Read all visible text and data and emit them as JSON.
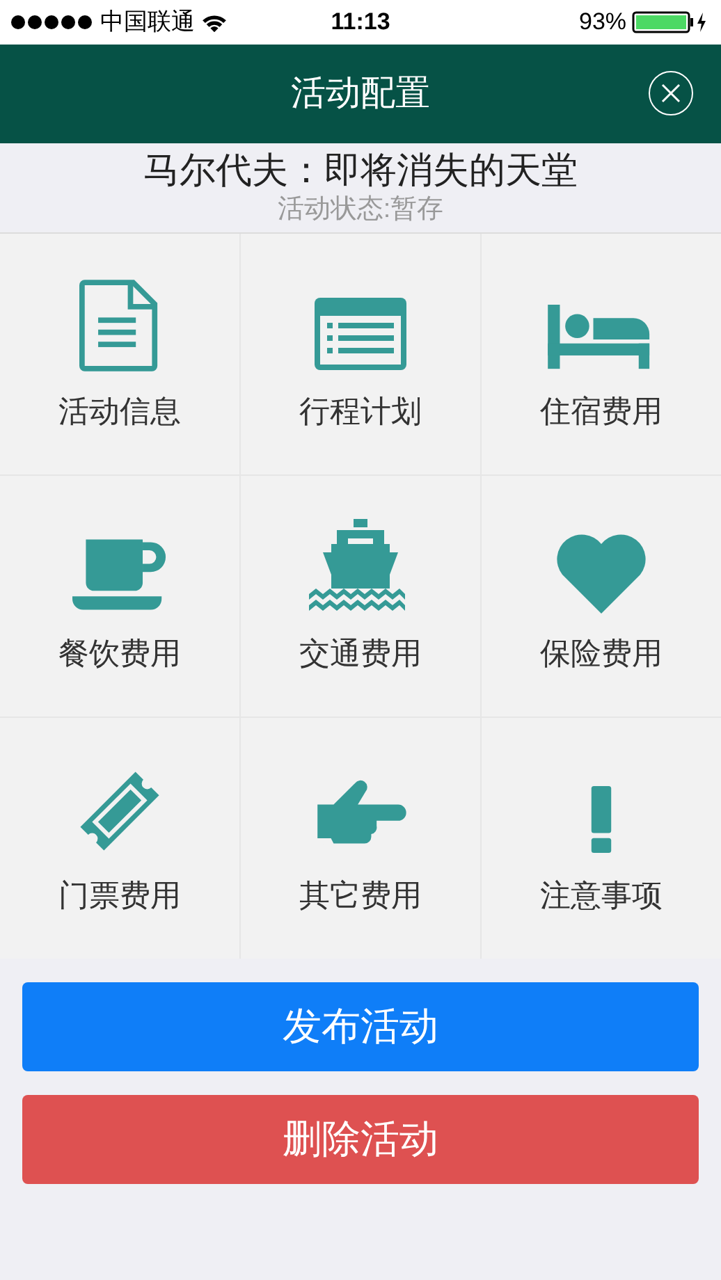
{
  "status_bar": {
    "carrier": "中国联通",
    "time": "11:13",
    "battery": "93%"
  },
  "header": {
    "title": "活动配置"
  },
  "activity": {
    "name": "马尔代夫：即将消失的天堂",
    "status": "活动状态:暂存"
  },
  "tiles": [
    {
      "label": "活动信息"
    },
    {
      "label": "行程计划"
    },
    {
      "label": "住宿费用"
    },
    {
      "label": "餐饮费用"
    },
    {
      "label": "交通费用"
    },
    {
      "label": "保险费用"
    },
    {
      "label": "门票费用"
    },
    {
      "label": "其它费用"
    },
    {
      "label": "注意事项"
    }
  ],
  "buttons": [
    {
      "label": "发布活动",
      "kind": "primary"
    },
    {
      "label": "删除活动",
      "kind": "danger"
    }
  ]
}
